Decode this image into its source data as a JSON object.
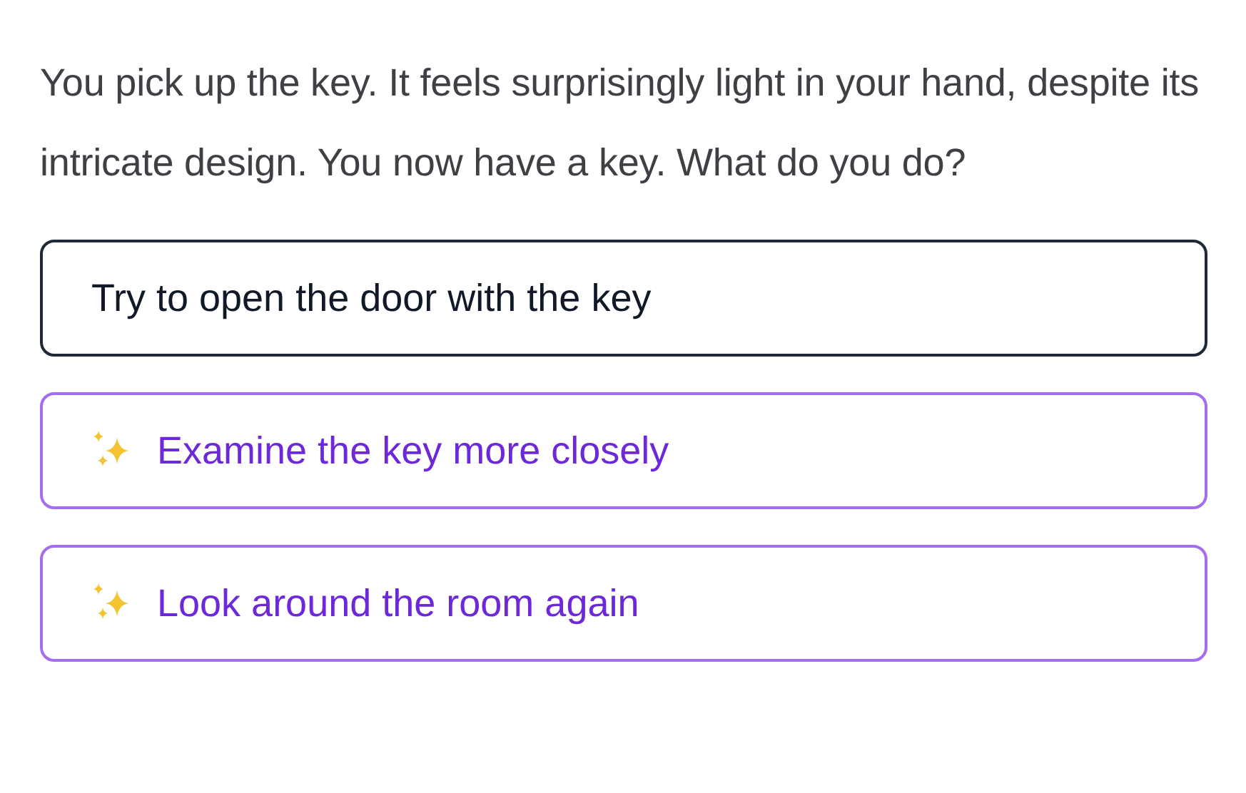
{
  "story": {
    "text": "You pick up the key. It feels surprisingly light in your hand, despite its intricate design. You now have a key. What do you do?"
  },
  "choices": [
    {
      "kind": "plain",
      "label": "Try to open the door with the key"
    },
    {
      "kind": "suggested",
      "label": "Examine the key more closely"
    },
    {
      "kind": "suggested",
      "label": "Look around the room again"
    }
  ]
}
